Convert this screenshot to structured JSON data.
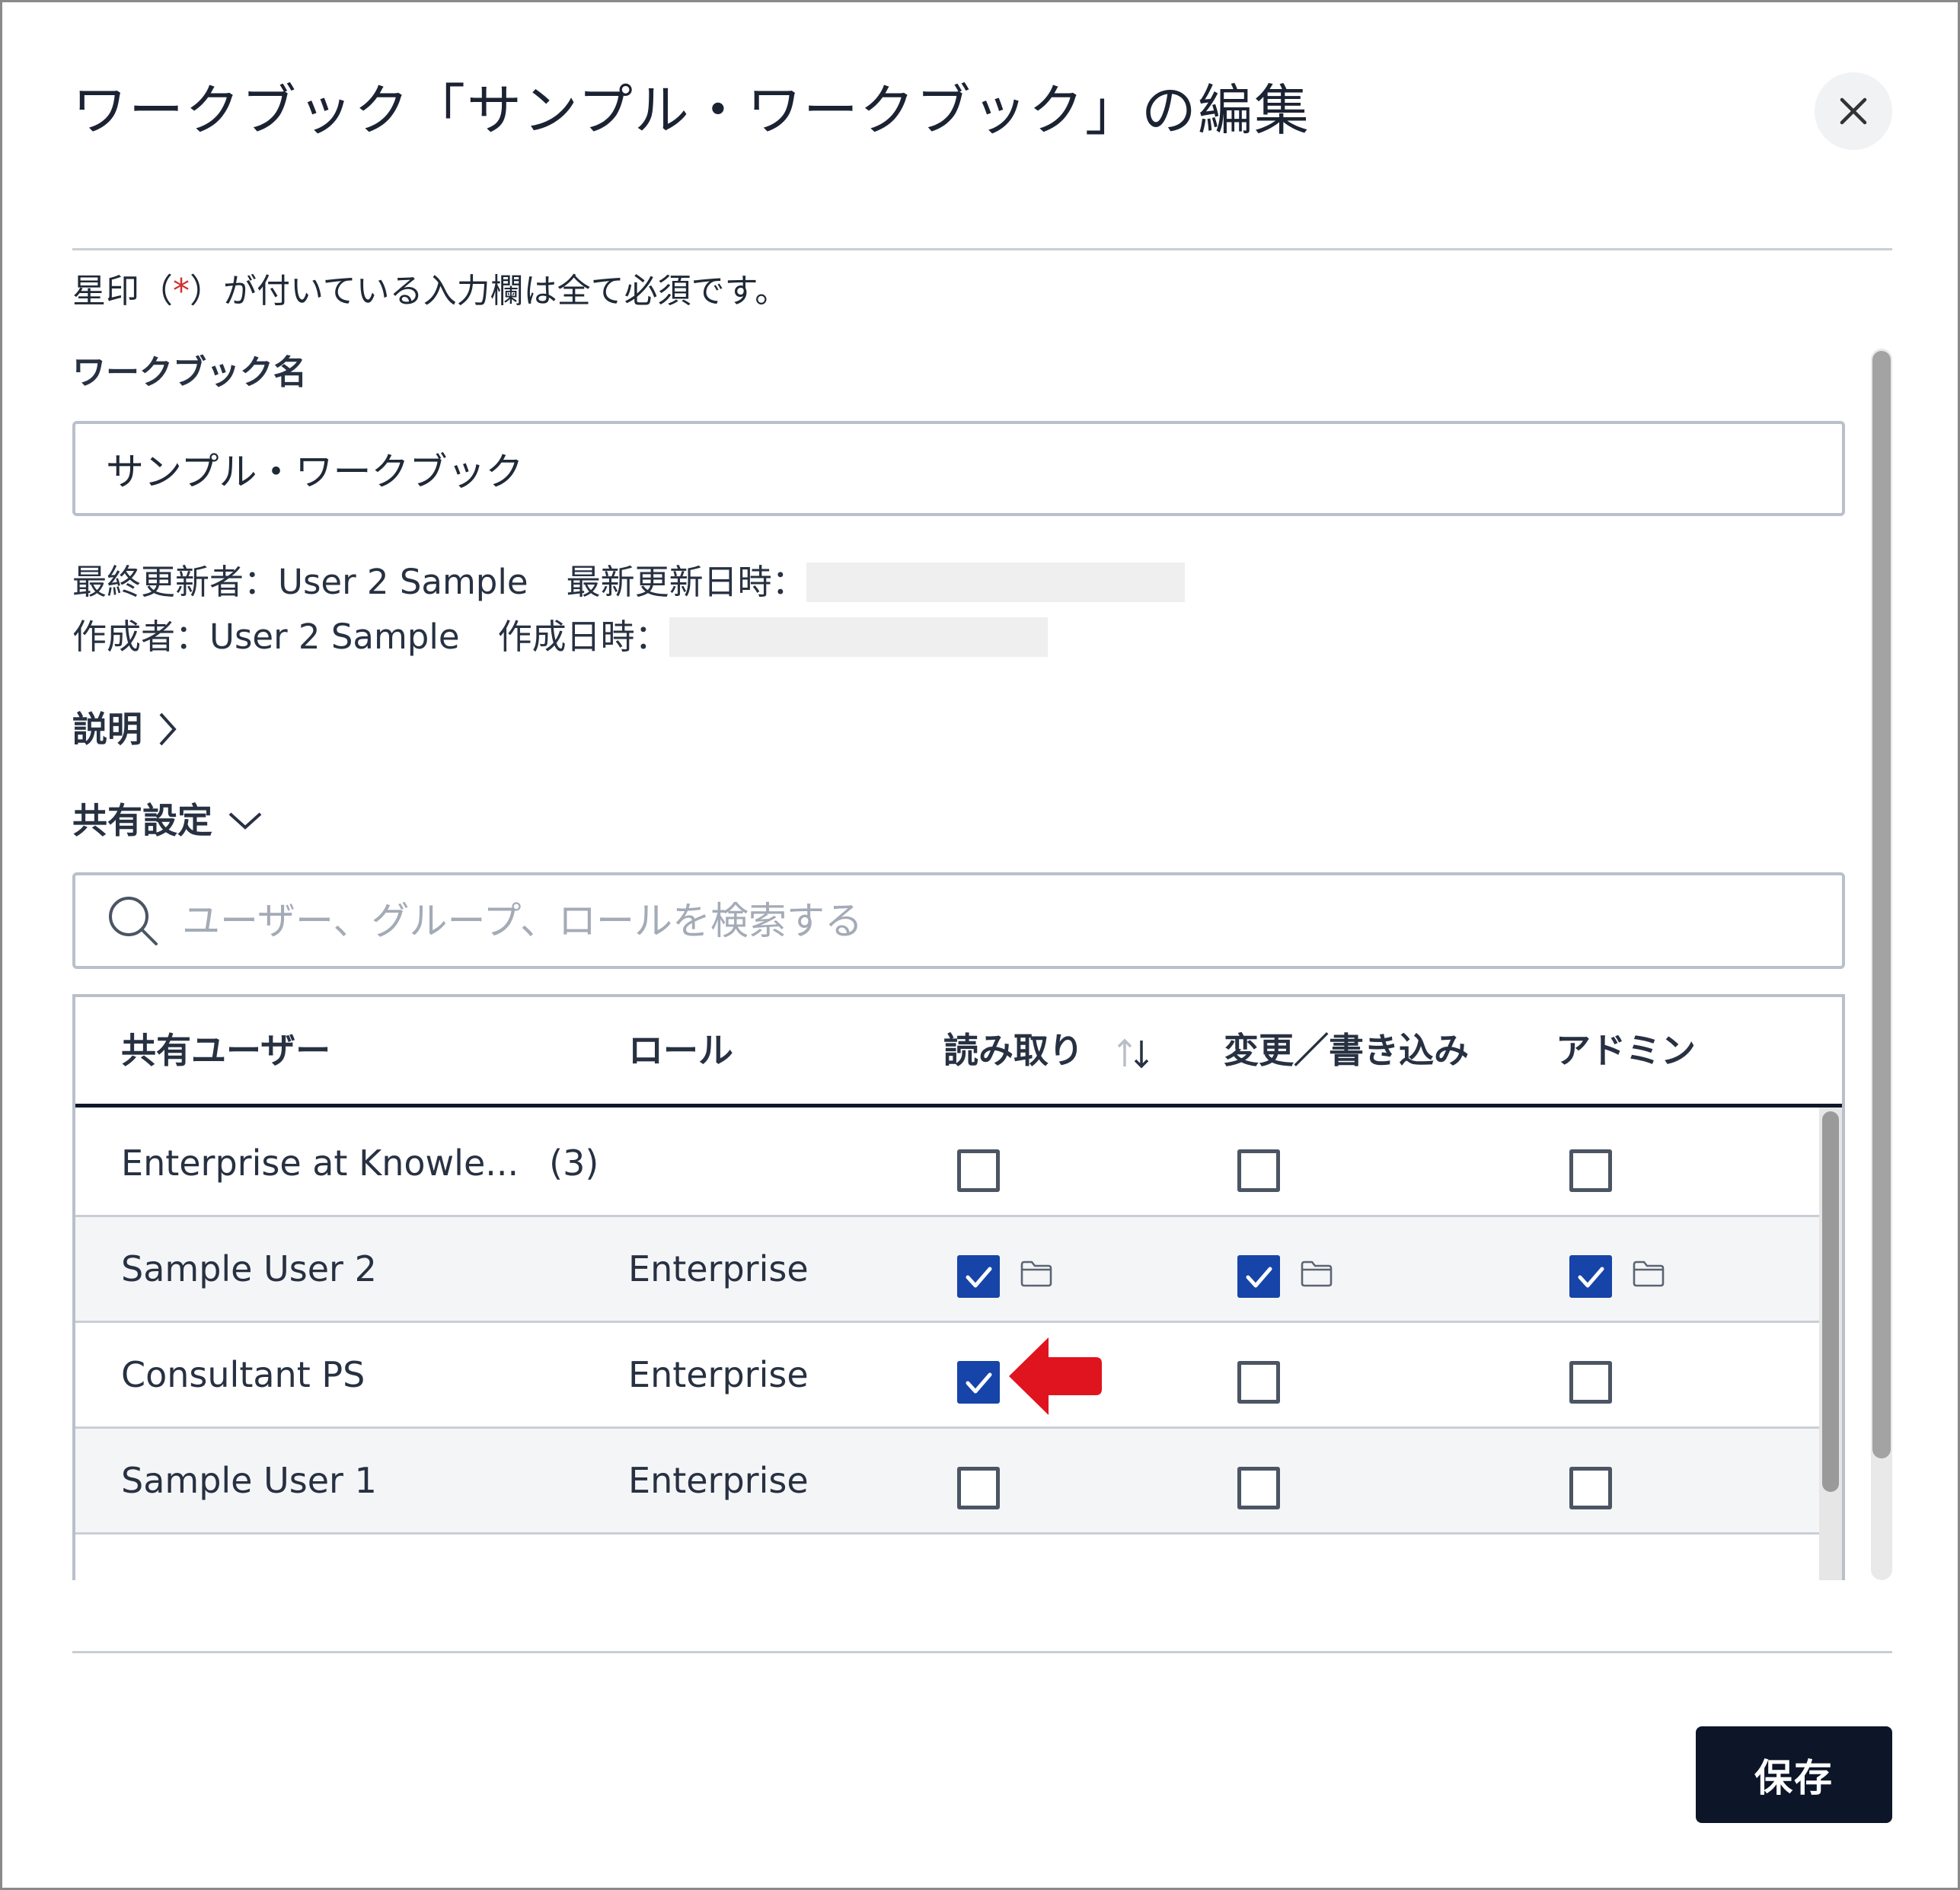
{
  "dialog": {
    "title": "ワークブック「サンプル・ワークブック」の編集",
    "close_icon": "close-icon"
  },
  "form": {
    "required_note_prefix": "星印（",
    "required_note_star": "*",
    "required_note_suffix": "）が付いている入力欄は全て必須です。",
    "workbook_name_label": "ワークブック名",
    "workbook_name_value": "サンプル・ワークブック"
  },
  "meta": {
    "last_updated_by_label": "最終更新者：",
    "last_updated_by": "User 2 Sample",
    "last_updated_at_label": "最新更新日時：",
    "created_by_label": "作成者：",
    "created_by": "User 2 Sample",
    "created_at_label": "作成日時："
  },
  "sections": {
    "description_label": "説明",
    "sharing_label": "共有設定"
  },
  "search": {
    "placeholder": "ユーザー、グループ、ロールを検索する",
    "icon": "search-icon"
  },
  "table": {
    "headers": {
      "user": "共有ユーザー",
      "role": "ロール",
      "read": "読み取り",
      "write": "変更／書き込み",
      "admin": "アドミン"
    },
    "rows": [
      {
        "name": "Enterprise at Knowle...",
        "count": "(3)",
        "role": "",
        "read": false,
        "write": false,
        "admin": false,
        "inherited": false
      },
      {
        "name": "Sample User 2",
        "count": "",
        "role": "Enterprise",
        "read": true,
        "write": true,
        "admin": true,
        "inherited": true
      },
      {
        "name": "Consultant PS",
        "count": "",
        "role": "Enterprise",
        "read": true,
        "write": false,
        "admin": false,
        "inherited": false
      },
      {
        "name": "Sample User 1",
        "count": "",
        "role": "Enterprise",
        "read": false,
        "write": false,
        "admin": false,
        "inherited": false
      }
    ]
  },
  "footer": {
    "save_label": "保存"
  },
  "colors": {
    "checkbox_checked": "#1644a8",
    "annotation_arrow": "#e0141e",
    "save_button": "#0d1628"
  }
}
